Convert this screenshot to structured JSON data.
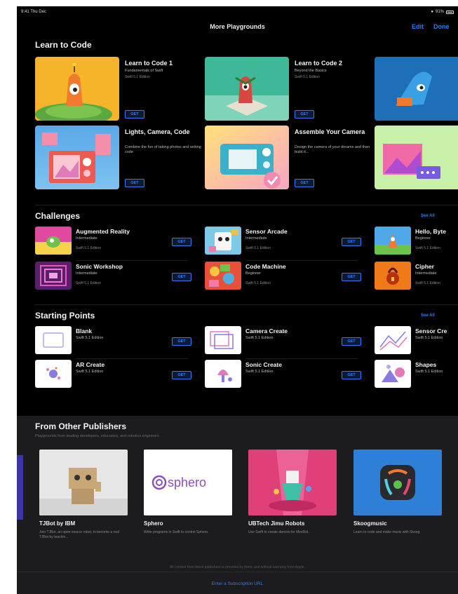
{
  "status": {
    "time": "9:41 Thu Dec",
    "battery": "91%"
  },
  "nav": {
    "title": "More Playgrounds",
    "edit": "Edit",
    "done": "Done"
  },
  "learn": {
    "title": "Learn to Code",
    "cards": [
      {
        "title": "Learn to Code 1",
        "subtitle": "Fundamentals of Swift",
        "edition": "Swift 5.1 Edition",
        "get": "GET"
      },
      {
        "title": "Learn to Code 2",
        "subtitle": "Beyond the Basics",
        "edition": "Swift 5.1 Edition",
        "get": "GET"
      },
      {
        "title": "Lights, Camera, Code",
        "subtitle": "Combine the fun of taking photos and writing code",
        "get": "GET"
      },
      {
        "title": "Assemble Your Camera",
        "subtitle": "Design the camera of your dreams and then build it...",
        "get": "GET"
      }
    ]
  },
  "challenges": {
    "title": "Challenges",
    "see_all": "See All",
    "items": [
      {
        "title": "Augmented Reality",
        "level": "Intermediate",
        "edition": "Swift 5.1 Edition",
        "get": "GET"
      },
      {
        "title": "Sensor Arcade",
        "level": "Intermediate",
        "edition": "Swift 5.1 Edition",
        "get": "GET"
      },
      {
        "title": "Hello, Byte",
        "level": "Beginner",
        "edition": "Swift 5.1 Edition"
      },
      {
        "title": "Sonic Workshop",
        "level": "Intermediate",
        "edition": "Swift 5.1 Edition",
        "get": "GET"
      },
      {
        "title": "Code Machine",
        "level": "Beginner",
        "edition": "Swift 5.1 Edition",
        "get": "GET"
      },
      {
        "title": "Cipher",
        "level": "Intermediate",
        "edition": "Swift 5.1 Edition"
      }
    ]
  },
  "starting": {
    "title": "Starting Points",
    "see_all": "See All",
    "items": [
      {
        "title": "Blank",
        "edition": "Swift 5.1 Edition",
        "get": "GET"
      },
      {
        "title": "Camera Create",
        "edition": "Swift 5.1 Edition",
        "get": "GET"
      },
      {
        "title": "Sensor Cre",
        "edition": "Swift 5.1 Edition"
      },
      {
        "title": "AR Create",
        "edition": "Swift 5.1 Edition",
        "get": "GET"
      },
      {
        "title": "Sonic Create",
        "edition": "Swift 5.1 Edition",
        "get": "GET"
      },
      {
        "title": "Shapes",
        "edition": "Swift 5.1 Edition"
      }
    ]
  },
  "publishers": {
    "title": "From Other Publishers",
    "subtitle": "Playgrounds from leading developers, educators, and robotics engineers",
    "items": [
      {
        "name": "TJBot by IBM",
        "desc": "Join TJBot, an open-source robot, to become a real TJBot by teachin..."
      },
      {
        "name": "Sphero",
        "logo": "sphero",
        "desc": "Write programs in Swift to control Sphero."
      },
      {
        "name": "UBTech Jimu Robots",
        "desc": "Use Swift to create dances for MeeBot."
      },
      {
        "name": "Skoogmusic",
        "desc": "Learn to code and make music with Skoog."
      }
    ],
    "notice": "All content from these publishers is provided by them, and without warranty from Apple.",
    "subscription": "Enter a Subscription URL"
  },
  "colors": {
    "accent": "#2f7cf6",
    "background": "#000000",
    "publishers_bg": "#1c1c1e"
  }
}
